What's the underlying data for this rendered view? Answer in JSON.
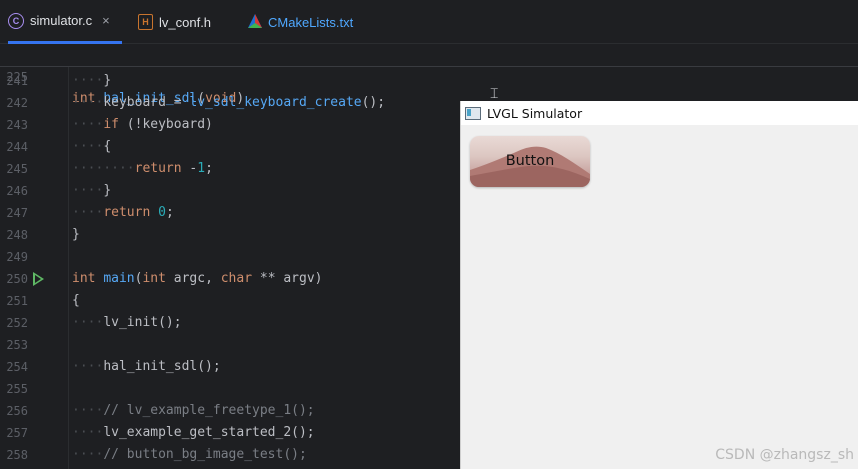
{
  "tabs": [
    {
      "label": "simulator.c",
      "icon": "c-file-icon",
      "active": true,
      "close": "×"
    },
    {
      "label": "lv_conf.h",
      "icon": "h-file-icon",
      "active": false
    },
    {
      "label": "CMakeLists.txt",
      "icon": "cmake-icon",
      "active": false
    }
  ],
  "icon_glyphs": {
    "c": "C",
    "h": "H"
  },
  "sticky_line": {
    "number": "225",
    "type": "int",
    "name": "hal_init_sdl",
    "params": "void"
  },
  "code_lines": [
    {
      "n": "241",
      "dots": "····",
      "text": "}"
    },
    {
      "n": "242",
      "dots": "····",
      "pre": "keyboard = ",
      "fn": "lv_sdl_keyboard_create",
      "post": "();"
    },
    {
      "n": "243",
      "dots": "····",
      "kw": "if",
      "post": " (!keyboard)"
    },
    {
      "n": "244",
      "dots": "····",
      "text": "{"
    },
    {
      "n": "245",
      "dots": "········",
      "kw": "return",
      "post": " -",
      "num": "1",
      "post2": ";"
    },
    {
      "n": "246",
      "dots": "····",
      "text": "}"
    },
    {
      "n": "247",
      "dots": "····",
      "kw": "return",
      "post": " ",
      "num": "0",
      "post2": ";"
    },
    {
      "n": "248",
      "dots": "",
      "text": "}"
    },
    {
      "n": "249",
      "dots": "",
      "text": ""
    },
    {
      "n": "250",
      "dots": "",
      "main_signature": {
        "kw1": "int",
        "fn": "main",
        "open": "(",
        "kw2": "int",
        "arg1": " argc, ",
        "kw3": "char",
        "arg2": " ** argv)"
      }
    },
    {
      "n": "251",
      "dots": "",
      "text": "{"
    },
    {
      "n": "252",
      "dots": "····",
      "text": "lv_init();"
    },
    {
      "n": "253",
      "dots": "",
      "text": ""
    },
    {
      "n": "254",
      "dots": "····",
      "text": "hal_init_sdl();"
    },
    {
      "n": "255",
      "dots": "",
      "text": ""
    },
    {
      "n": "256",
      "dots": "····",
      "comment": "// lv_example_freetype_1();"
    },
    {
      "n": "257",
      "dots": "····",
      "text": "lv_example_get_started_2();"
    },
    {
      "n": "258",
      "dots": "····",
      "comment": "// button_bg_image_test();"
    }
  ],
  "simulator": {
    "title": "LVGL Simulator",
    "button_label": "Button"
  },
  "watermark": "CSDN @zhangsz_sh",
  "colors": {
    "editor_bg": "#1e1f22",
    "keyword": "#cf8e6d",
    "function": "#56a8f5",
    "number": "#2aacb8",
    "comment": "#7a7e85",
    "active_tab_underline": "#3574f0"
  }
}
